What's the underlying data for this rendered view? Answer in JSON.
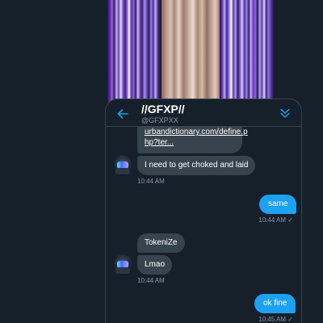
{
  "chat": {
    "title": "//GFXP//",
    "handle": "@GFXPXX",
    "back_icon": "arrow-left-icon",
    "collapse_icon": "double-chevron-down-icon"
  },
  "messages": [
    {
      "side": "in",
      "text": "urbandictionary.com/define.php?ter...",
      "link_line1": "urbandictionary.com/define.p",
      "link_line2": "hp?ter..."
    },
    {
      "side": "in",
      "text": "I need to get choked and laid"
    },
    {
      "side": "in",
      "time": "10:44 AM"
    },
    {
      "side": "out",
      "text": "same",
      "time": "10:44 AM",
      "read_mark": "✓"
    },
    {
      "side": "in",
      "text": "TokeniZe"
    },
    {
      "side": "in",
      "text": "Lmao",
      "time": "10:44 AM"
    },
    {
      "side": "out",
      "text": "ok fine",
      "time": "10:45 AM",
      "read_mark": "✓"
    }
  ],
  "colors": {
    "background": "#15202b",
    "incoming_bubble": "#38444d",
    "outgoing_bubble": "#1da1f2",
    "accent": "#1da1f2",
    "muted_text": "#8899a6"
  }
}
